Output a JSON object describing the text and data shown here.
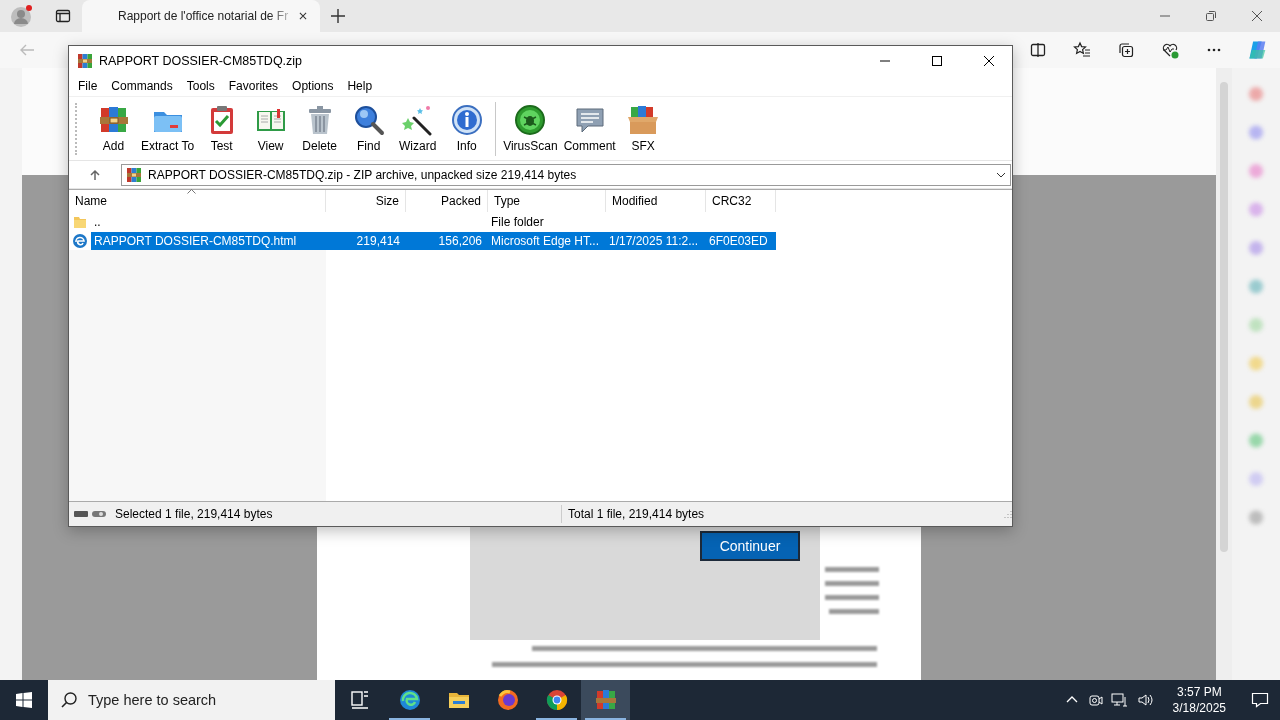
{
  "browser": {
    "tab_title": "Rapport de l'office notarial de Fr",
    "page": {
      "button": "Continuer"
    }
  },
  "winrar": {
    "title": "RAPPORT DOSSIER-CM85TDQ.zip",
    "menu": [
      "File",
      "Commands",
      "Tools",
      "Favorites",
      "Options",
      "Help"
    ],
    "toolbar": [
      {
        "kind": "add",
        "label": "Add"
      },
      {
        "kind": "extract",
        "label": "Extract To"
      },
      {
        "kind": "test",
        "label": "Test"
      },
      {
        "kind": "view",
        "label": "View"
      },
      {
        "kind": "delete",
        "label": "Delete"
      },
      {
        "kind": "find",
        "label": "Find"
      },
      {
        "kind": "wizard",
        "label": "Wizard"
      },
      {
        "kind": "info",
        "label": "Info"
      },
      {
        "kind": "virusscan",
        "label": "VirusScan",
        "divider_before": true
      },
      {
        "kind": "comment",
        "label": "Comment"
      },
      {
        "kind": "sfx",
        "label": "SFX"
      }
    ],
    "path": "RAPPORT DOSSIER-CM85TDQ.zip - ZIP archive, unpacked size 219,414 bytes",
    "columns": [
      "Name",
      "Size",
      "Packed",
      "Type",
      "Modified",
      "CRC32"
    ],
    "rows": [
      {
        "kind": "folder",
        "name": "..",
        "type": "File folder",
        "selected": false
      },
      {
        "kind": "html",
        "name": "RAPPORT DOSSIER-CM85TDQ.html",
        "size": "219,414",
        "packed": "156,206",
        "type": "Microsoft Edge HT...",
        "modified": "1/17/2025 11:2...",
        "crc32": "6F0E03ED",
        "selected": true
      }
    ],
    "status_left": "Selected 1 file, 219,414 bytes",
    "status_right": "Total 1 file, 219,414 bytes"
  },
  "taskbar": {
    "search_placeholder": "Type here to search",
    "apps": [
      {
        "kind": "taskview",
        "running": false,
        "selected": false
      },
      {
        "kind": "edge",
        "running": true,
        "selected": false
      },
      {
        "kind": "explorer",
        "running": false,
        "selected": false
      },
      {
        "kind": "firefox",
        "running": false,
        "selected": false
      },
      {
        "kind": "chrome",
        "running": true,
        "selected": false
      },
      {
        "kind": "winrar",
        "running": true,
        "selected": true
      }
    ],
    "time": "3:57 PM",
    "date": "3/18/2025"
  }
}
